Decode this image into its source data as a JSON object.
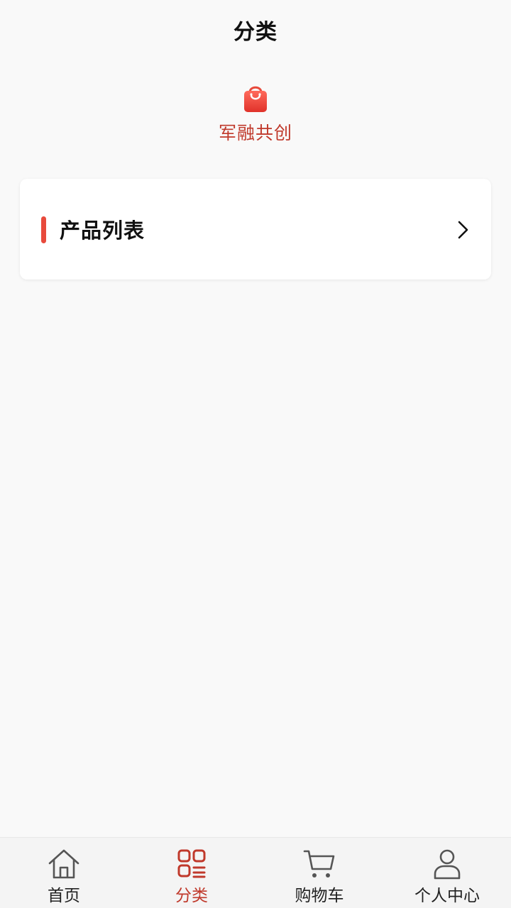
{
  "header": {
    "title": "分类"
  },
  "categories": [
    {
      "label": "军融共创",
      "icon": "shopping-bag-icon",
      "color": "#e84a3c"
    }
  ],
  "list": {
    "label": "产品列表",
    "accent_color": "#e84a3c"
  },
  "tabbar": {
    "active_color": "#c0392b",
    "items": [
      {
        "label": "首页",
        "icon": "home-icon",
        "active": false
      },
      {
        "label": "分类",
        "icon": "category-grid-icon",
        "active": true
      },
      {
        "label": "购物车",
        "icon": "cart-icon",
        "active": false
      },
      {
        "label": "个人中心",
        "icon": "user-icon",
        "active": false
      }
    ]
  }
}
